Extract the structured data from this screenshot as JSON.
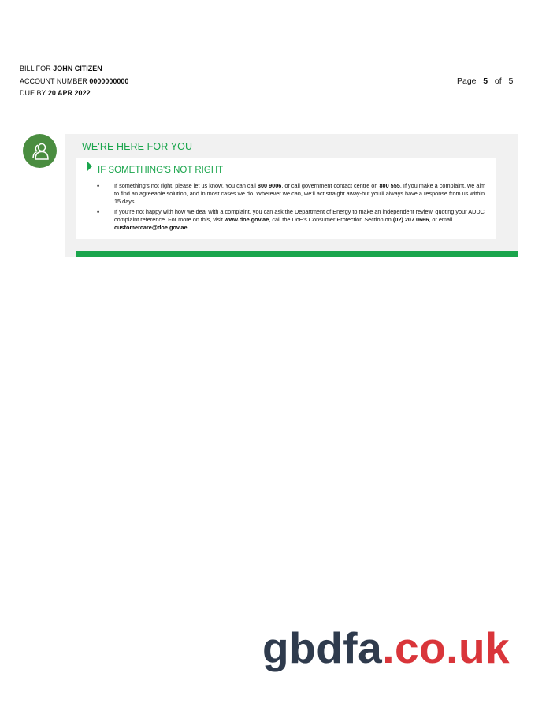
{
  "header": {
    "bill_for_label": "BILL FOR",
    "bill_for_name": "JOHN CITIZEN",
    "account_label": "ACCOUNT NUMBER",
    "account_number": "0000000000",
    "due_label": "DUE BY",
    "due_date": "20 APR 2022"
  },
  "page": {
    "label": "Page",
    "current": "5",
    "of_label": "of",
    "total": "5"
  },
  "section": {
    "icon": "people-icon",
    "heading": "WE'RE HERE FOR YOU",
    "subheading": "IF SOMETHING'S NOT RIGHT",
    "bullet1": {
      "t1": "If something's not right, please let us know. You can call ",
      "phone1": "800 9006",
      "t2": ", or call government contact centre on ",
      "phone2": "800 555",
      "t3": ". If you make a complaint, we aim to find an agreeable solution, and in most cases we do. Wherever we can, we'll act straight away-but you'll always have a response from us within 15 days."
    },
    "bullet2": {
      "t1": "If you're not happy with how we deal with a complaint, you can ask the Department of Energy to make an independent review, quoting your ADDC complaint reference. For more on this, visit ",
      "website": "www.doe.gov.ae",
      "t2": ", call the DoE's Consumer Protection Section on ",
      "phone": "(02) 207 0666",
      "t3": ", or email ",
      "email": "customercare@doe.gov.ae"
    }
  },
  "watermark": {
    "part1": "gbdfa",
    "part2": ".co.uk"
  },
  "colors": {
    "accent_green": "#1aa54c",
    "icon_green": "#4a8d40",
    "panel_gray": "#f1f1f1",
    "watermark_dark": "#2f3b4d",
    "watermark_red": "#d9353a"
  }
}
